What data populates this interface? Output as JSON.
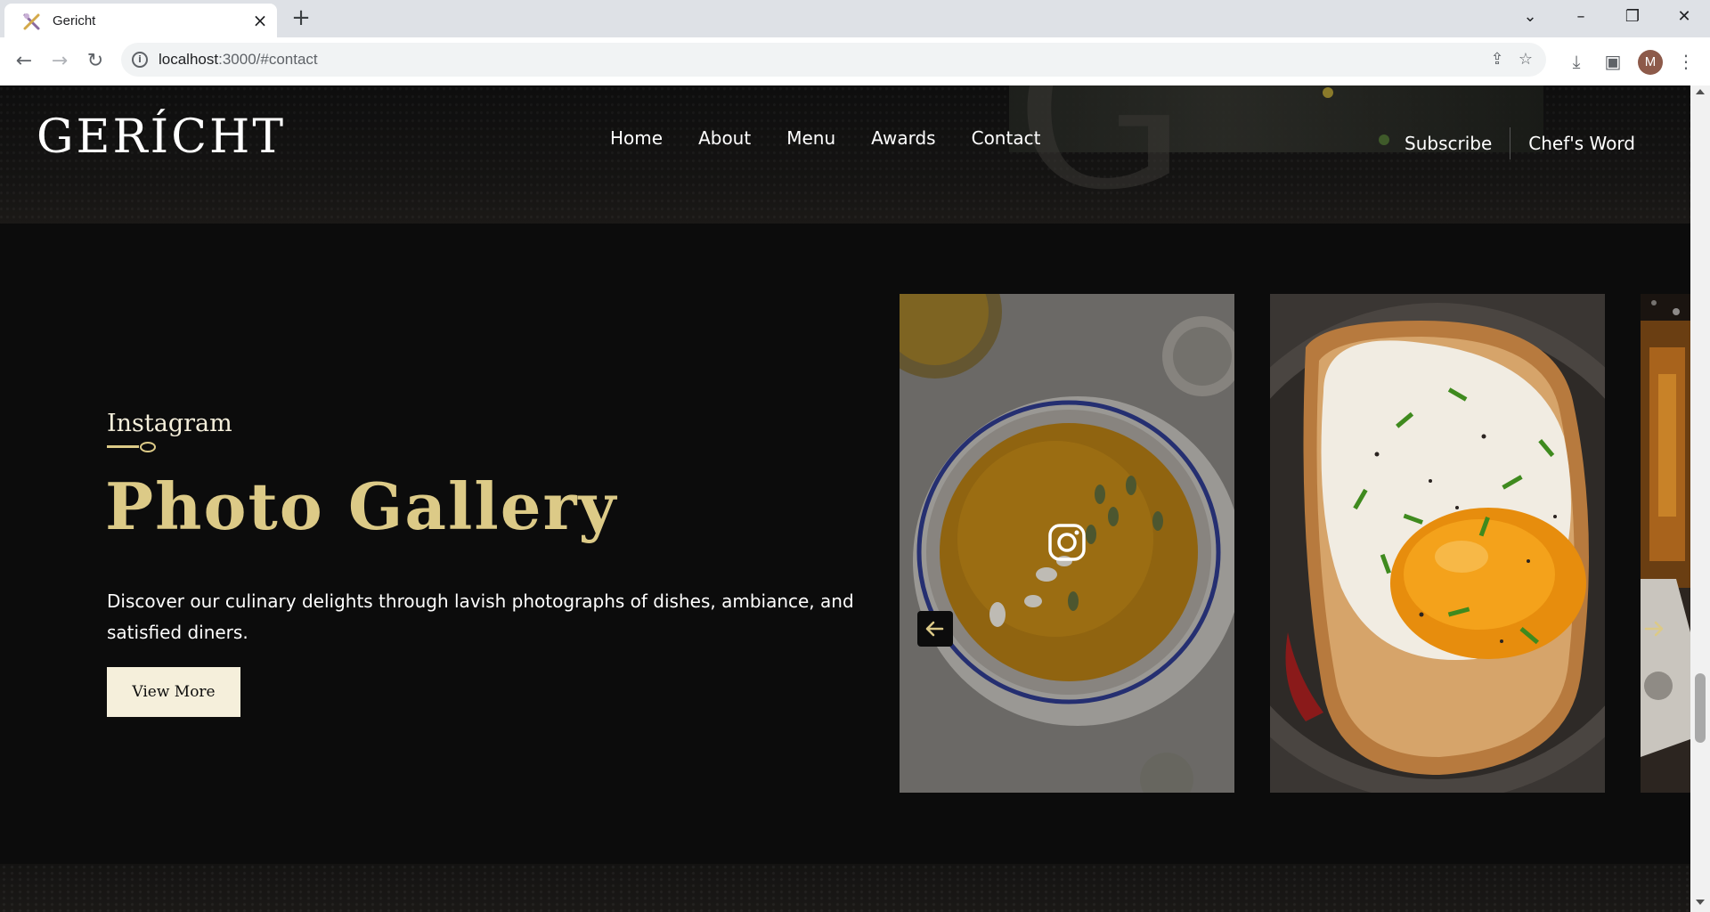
{
  "browser": {
    "tab_title": "Gericht",
    "url_host": "localhost",
    "url_path": ":3000/#contact",
    "profile_initial": "M"
  },
  "nav": {
    "logo": "GERÍCHT",
    "links": [
      "Home",
      "About",
      "Menu",
      "Awards",
      "Contact"
    ],
    "subscribe": "Subscribe",
    "chefs_word": "Chef's Word"
  },
  "gallery": {
    "subtitle": "Instagram",
    "title": "Photo Gallery",
    "description": "Discover our culinary delights through lavish photographs of dishes, ambiance, and satisfied diners.",
    "cta": "View More",
    "images": [
      "soup-bowl-photo",
      "fried-egg-toast-photo",
      "drink-photo"
    ]
  },
  "colors": {
    "gold": "#dcca87",
    "crimson": "#f5efdb",
    "black": "#0c0c0c"
  }
}
